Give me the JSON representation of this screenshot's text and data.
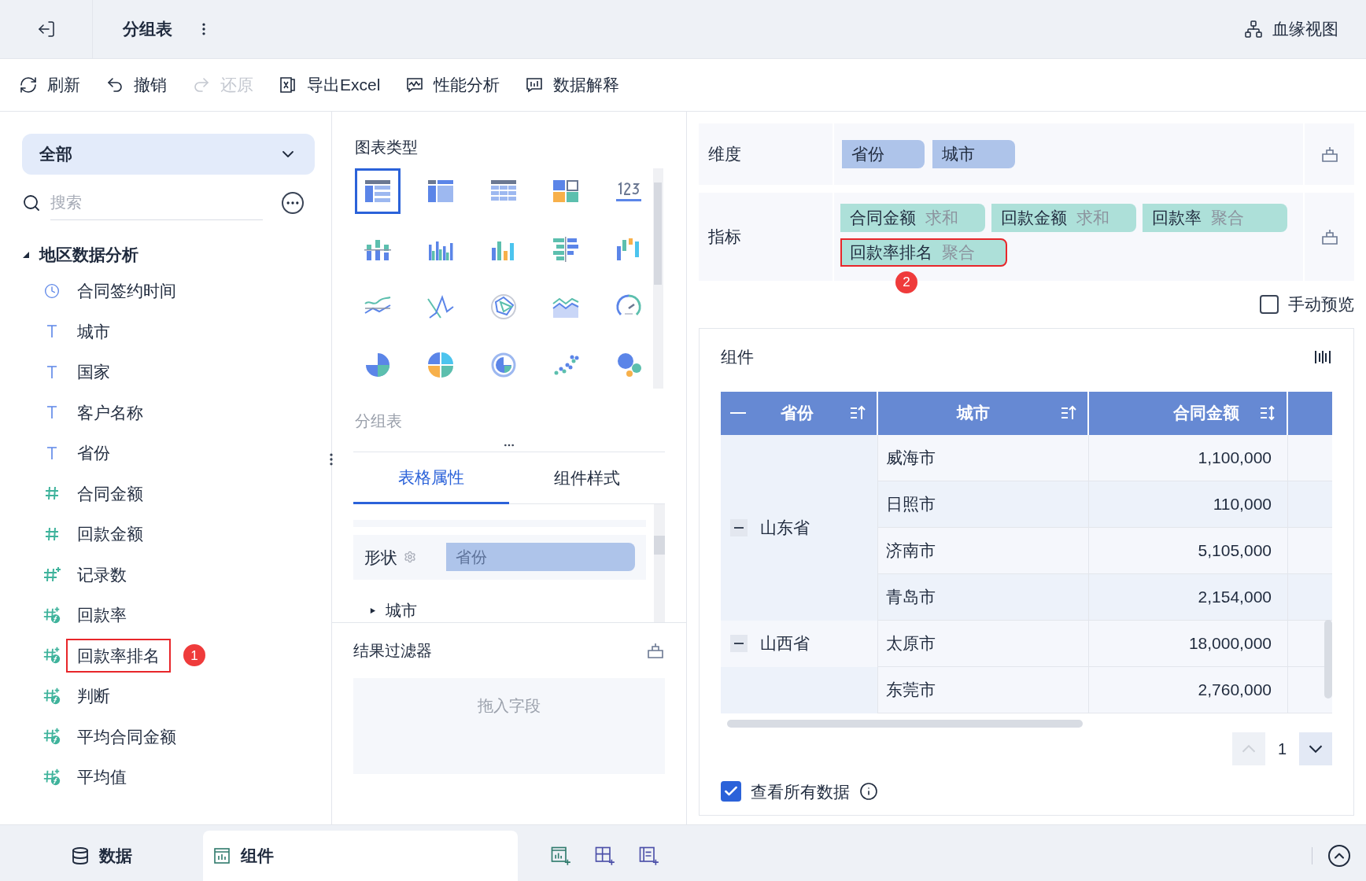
{
  "header": {
    "title": "分组表",
    "lineage": "血缘视图"
  },
  "toolbar": [
    {
      "kind": "refresh",
      "label": "刷新",
      "disabled": false
    },
    {
      "kind": "undo",
      "label": "撤销",
      "disabled": false
    },
    {
      "kind": "redo",
      "label": "还原",
      "disabled": true
    },
    {
      "kind": "excel",
      "label": "导出Excel",
      "disabled": false
    },
    {
      "kind": "perf",
      "label": "性能分析",
      "disabled": false
    },
    {
      "kind": "explain",
      "label": "数据解释",
      "disabled": false
    }
  ],
  "fields": {
    "dropdown": "全部",
    "search_placeholder": "搜索",
    "folder": {
      "label": "地区数据分析",
      "expanded": true,
      "children": [
        {
          "label": "合同签约时间",
          "kind": "date",
          "highlighted": false
        },
        {
          "label": "城市",
          "kind": "text",
          "highlighted": false
        },
        {
          "label": "国家",
          "kind": "text",
          "highlighted": false
        },
        {
          "label": "客户名称",
          "kind": "text",
          "highlighted": false
        },
        {
          "label": "省份",
          "kind": "text",
          "highlighted": false
        },
        {
          "label": "合同金额",
          "kind": "number",
          "highlighted": false
        },
        {
          "label": "回款金额",
          "kind": "number",
          "highlighted": false
        },
        {
          "label": "记录数",
          "kind": "count",
          "highlighted": false
        },
        {
          "label": "回款率",
          "kind": "calc",
          "highlighted": false
        },
        {
          "label": "回款率排名",
          "kind": "calc",
          "highlighted": true,
          "badge": "1"
        },
        {
          "label": "判断",
          "kind": "calc",
          "highlighted": false
        },
        {
          "label": "平均合同金额",
          "kind": "calc",
          "highlighted": false
        },
        {
          "label": "平均值",
          "kind": "calc",
          "highlighted": false
        }
      ]
    }
  },
  "chart_types": {
    "title": "图表类型",
    "current": "分组表",
    "items": [
      {
        "kind": "group-table",
        "selected": true
      },
      {
        "kind": "cross-table",
        "selected": false
      },
      {
        "kind": "detail-table",
        "selected": false
      },
      {
        "kind": "blocks",
        "selected": false
      },
      {
        "kind": "number",
        "selected": false
      },
      {
        "kind": "stacked-bar",
        "selected": false
      },
      {
        "kind": "grouped-bar",
        "selected": false
      },
      {
        "kind": "bar",
        "selected": false
      },
      {
        "kind": "hbar",
        "selected": false
      },
      {
        "kind": "waterfall",
        "selected": false
      },
      {
        "kind": "line",
        "selected": false
      },
      {
        "kind": "zigzag",
        "selected": false
      },
      {
        "kind": "radar",
        "selected": false
      },
      {
        "kind": "area",
        "selected": false
      },
      {
        "kind": "gauge",
        "selected": false
      },
      {
        "kind": "pie",
        "selected": false
      },
      {
        "kind": "multi-pie",
        "selected": false
      },
      {
        "kind": "ring",
        "selected": false
      },
      {
        "kind": "scatter",
        "selected": false
      },
      {
        "kind": "bubble",
        "selected": false
      }
    ]
  },
  "properties": {
    "tabs": [
      {
        "label": "表格属性",
        "selected": true
      },
      {
        "label": "组件样式",
        "selected": false
      }
    ],
    "shape_label": "形状",
    "shape_value": "省份",
    "sub_field": "城市"
  },
  "filter": {
    "title": "结果过滤器",
    "placeholder": "拖入字段"
  },
  "dimensions": {
    "label": "维度",
    "fields": [
      "省份",
      "城市"
    ]
  },
  "measures": {
    "label": "指标",
    "fields": [
      {
        "name": "合同金额",
        "agg": "求和",
        "highlighted": false
      },
      {
        "name": "回款金额",
        "agg": "求和",
        "highlighted": false
      },
      {
        "name": "回款率",
        "agg": "聚合",
        "highlighted": false
      },
      {
        "name": "回款率排名",
        "agg": "聚合",
        "highlighted": true,
        "badge": "2"
      }
    ]
  },
  "manual_preview": {
    "label": "手动预览",
    "checked": false
  },
  "component": {
    "title": "组件",
    "columns": [
      {
        "label": "省份",
        "kind": "asc"
      },
      {
        "label": "城市",
        "kind": "asc"
      },
      {
        "label": "合同金额",
        "kind": "both"
      }
    ],
    "groups": [
      {
        "province": "山东省",
        "expanded": true,
        "rows": [
          [
            "威海市",
            "1,100,000"
          ],
          [
            "日照市",
            "110,000"
          ],
          [
            "济南市",
            "5,105,000"
          ],
          [
            "青岛市",
            "2,154,000"
          ]
        ]
      },
      {
        "province": "山西省",
        "expanded": true,
        "rows": [
          [
            "太原市",
            "18,000,000"
          ]
        ]
      },
      {
        "rows": [
          [
            "东莞市",
            "2,760,000"
          ]
        ]
      }
    ],
    "page": "1",
    "view_all": {
      "label": "查看所有数据",
      "checked": true
    }
  },
  "bottom_tabs": [
    {
      "kind": "data",
      "label": "数据",
      "selected": false
    },
    {
      "kind": "component",
      "label": "组件",
      "selected": true
    }
  ]
}
